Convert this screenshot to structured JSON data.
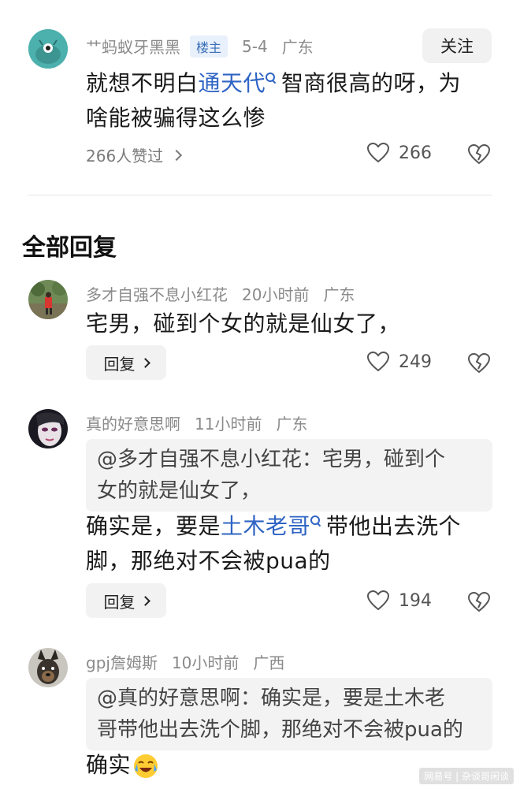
{
  "comment": {
    "author": "艹蚂蚁牙黑黑",
    "op_tag": "楼主",
    "date": "5-4",
    "location": "广东",
    "follow_label": "关注",
    "text_before": "就想不明白",
    "link": "通天代",
    "text_after_line1": "智商很高的呀，为",
    "text_line2": "啥能被骗得这么惨",
    "likers": "266人赞过",
    "likes": "266"
  },
  "section_title": "全部回复",
  "replies": [
    {
      "author": "多才自强不息小红花",
      "time": "20小时前",
      "location": "广东",
      "text": "宅男，碰到个女的就是仙女了，",
      "reply_label": "回复",
      "likes": "249"
    },
    {
      "author": "真的好意思啊",
      "time": "11小时前",
      "location": "广东",
      "quote_line1": "@多才自强不息小红花：宅男，碰到个",
      "quote_line2": "女的就是仙女了，",
      "text_before": "确实是，要是",
      "link": "土木老哥",
      "text_after": "带他出去洗个",
      "text_line2": "脚，那绝对不会被pua的",
      "reply_label": "回复",
      "likes": "194"
    },
    {
      "author": "gpj詹姆斯",
      "time": "10小时前",
      "location": "广西",
      "quote_line1": "@真的好意思啊：确实是，要是土木老",
      "quote_line2": "哥带他出去洗个脚，那绝对不会被pua的",
      "text": "确实"
    }
  ],
  "watermark": "网易号 | 杂谈哥闲谈",
  "colors": {
    "link": "#2f64c4",
    "op_tag_bg": "#e8f0fb",
    "op_tag_text": "#3a6fb8"
  }
}
